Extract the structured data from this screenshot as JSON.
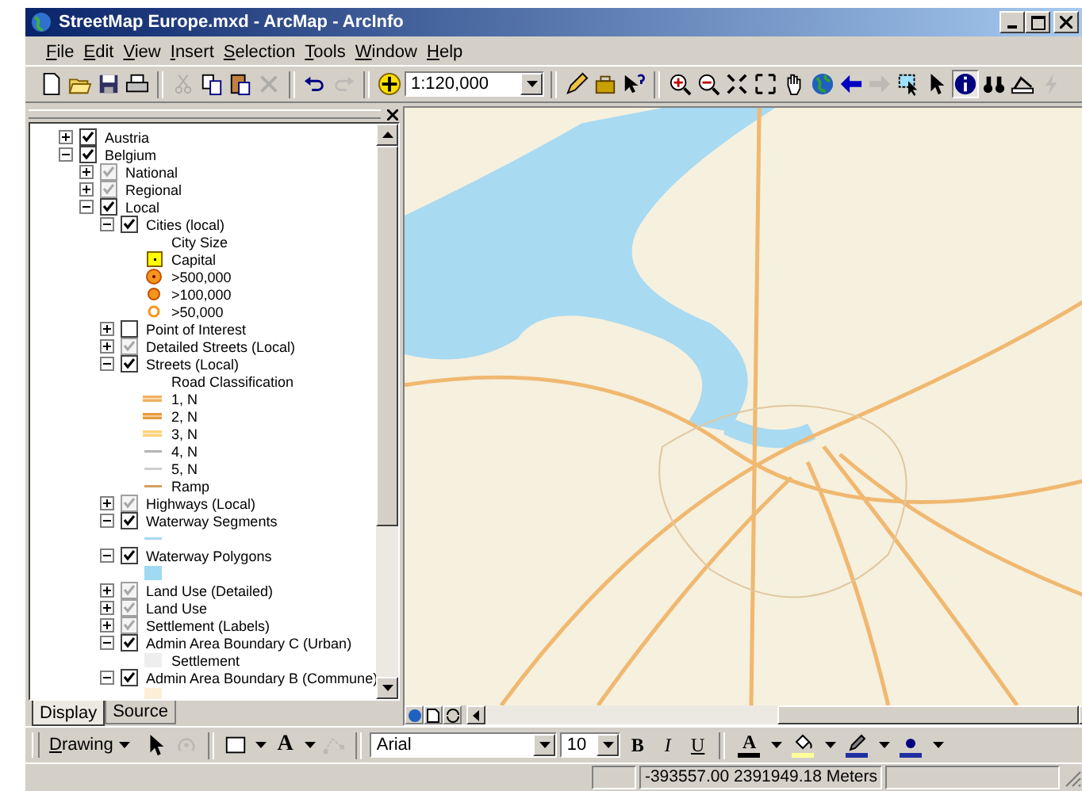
{
  "window": {
    "title": "StreetMap Europe.mxd - ArcMap - ArcInfo"
  },
  "menu": [
    "File",
    "Edit",
    "View",
    "Insert",
    "Selection",
    "Tools",
    "Window",
    "Help"
  ],
  "toolbar": [
    {
      "kind": "new",
      "disabled": false
    },
    {
      "kind": "open",
      "disabled": false
    },
    {
      "kind": "save",
      "disabled": false
    },
    {
      "kind": "print",
      "disabled": false
    },
    {
      "kind": "separator"
    },
    {
      "kind": "cut",
      "disabled": true
    },
    {
      "kind": "copy",
      "disabled": false
    },
    {
      "kind": "paste",
      "disabled": false
    },
    {
      "kind": "delete",
      "disabled": true
    },
    {
      "kind": "separator"
    },
    {
      "kind": "undo",
      "disabled": false
    },
    {
      "kind": "redo",
      "disabled": true
    },
    {
      "kind": "separator"
    },
    {
      "kind": "add-data",
      "disabled": false
    },
    {
      "kind": "scale",
      "value": "1:120,000"
    },
    {
      "kind": "separator"
    },
    {
      "kind": "editor",
      "disabled": false
    },
    {
      "kind": "toolbox",
      "disabled": false
    },
    {
      "kind": "whats-this",
      "disabled": false
    },
    {
      "kind": "separator"
    },
    {
      "kind": "zoom-in",
      "disabled": false,
      "selected": false
    },
    {
      "kind": "zoom-out",
      "disabled": false,
      "selected": false
    },
    {
      "kind": "fixed-in",
      "disabled": false
    },
    {
      "kind": "fixed-out",
      "disabled": false
    },
    {
      "kind": "pan",
      "disabled": false,
      "selected": false
    },
    {
      "kind": "globe",
      "disabled": false
    },
    {
      "kind": "back",
      "disabled": false
    },
    {
      "kind": "forward",
      "disabled": true
    },
    {
      "kind": "select-features",
      "disabled": false,
      "selected": false
    },
    {
      "kind": "pointer",
      "disabled": false,
      "selected": false
    },
    {
      "kind": "identify",
      "disabled": false,
      "selected": true
    },
    {
      "kind": "find",
      "disabled": false
    },
    {
      "kind": "measure",
      "disabled": false,
      "selected": false
    },
    {
      "kind": "hyperlink",
      "disabled": true,
      "selected": false
    }
  ],
  "toc": {
    "layers": [
      {
        "label": "Austria",
        "expanded": false,
        "checked": true,
        "dimmed": false
      },
      {
        "label": "Belgium",
        "expanded": true,
        "checked": true,
        "dimmed": false,
        "children": [
          {
            "label": "National",
            "expanded": false,
            "checked": true,
            "dimmed": true
          },
          {
            "label": "Regional",
            "expanded": false,
            "checked": true,
            "dimmed": true
          },
          {
            "label": "Local",
            "expanded": true,
            "checked": true,
            "dimmed": false,
            "children": [
              {
                "label": "Cities (local)",
                "expanded": true,
                "checked": true,
                "dimmed": false,
                "legend": [
                  {
                    "kind": "heading",
                    "label": "City Size"
                  },
                  {
                    "kind": "square",
                    "label": "Capital",
                    "color": "#ffff00"
                  },
                  {
                    "kind": "ring",
                    "label": ">500,000",
                    "color": "#f7941d"
                  },
                  {
                    "kind": "dot",
                    "label": ">100,000",
                    "color": "#f7941d"
                  },
                  {
                    "kind": "hollow",
                    "label": ">50,000",
                    "color": "#f7941d"
                  }
                ]
              },
              {
                "label": "Point of Interest",
                "expanded": false,
                "checked": false,
                "dimmed": false
              },
              {
                "label": "Detailed Streets (Local)",
                "expanded": false,
                "checked": true,
                "dimmed": true
              },
              {
                "label": "Streets (Local)",
                "expanded": true,
                "checked": true,
                "dimmed": false,
                "legend": [
                  {
                    "kind": "heading",
                    "label": "Road Classification"
                  },
                  {
                    "kind": "double-line",
                    "label": "1, N",
                    "color": "#f0b060"
                  },
                  {
                    "kind": "double-line",
                    "label": "2, N",
                    "color": "#e89a3c"
                  },
                  {
                    "kind": "double-line",
                    "label": "3, N",
                    "color": "#ffd27a"
                  },
                  {
                    "kind": "line",
                    "label": "4, N",
                    "color": "#b4b4b4"
                  },
                  {
                    "kind": "line",
                    "label": "5, N",
                    "color": "#cfcfcf"
                  },
                  {
                    "kind": "line",
                    "label": "Ramp",
                    "color": "#d4a060"
                  }
                ]
              },
              {
                "label": "Highways (Local)",
                "expanded": false,
                "checked": true,
                "dimmed": true
              },
              {
                "label": "Waterway Segments",
                "expanded": true,
                "checked": true,
                "dimmed": false,
                "legend": [
                  {
                    "kind": "line",
                    "color": "#a8d8f0"
                  }
                ]
              },
              {
                "label": "Waterway Polygons",
                "expanded": true,
                "checked": true,
                "dimmed": false,
                "legend": [
                  {
                    "kind": "fill",
                    "color": "#9fd9f2"
                  }
                ]
              },
              {
                "label": "Land Use (Detailed)",
                "expanded": false,
                "checked": true,
                "dimmed": true
              },
              {
                "label": "Land Use",
                "expanded": false,
                "checked": true,
                "dimmed": true
              },
              {
                "label": "Settlement (Labels)",
                "expanded": false,
                "checked": true,
                "dimmed": true
              },
              {
                "label": "Admin Area Boundary C (Urban)",
                "expanded": true,
                "checked": true,
                "dimmed": false,
                "legend": [
                  {
                    "kind": "fill",
                    "label": "Settlement",
                    "color": "#eeeeee"
                  }
                ]
              },
              {
                "label": "Admin Area Boundary B (Commune)",
                "expanded": true,
                "checked": true,
                "dimmed": false,
                "legend": [
                  {
                    "kind": "fill",
                    "color": "#fdeed8"
                  }
                ]
              }
            ]
          }
        ]
      }
    ],
    "tabs": [
      {
        "label": "Display",
        "selected": true
      },
      {
        "label": "Source",
        "selected": false
      }
    ]
  },
  "drawing_toolbar": [
    {
      "kind": "menu",
      "label": "Drawing"
    },
    {
      "kind": "pointer",
      "disabled": false
    },
    {
      "kind": "rotate",
      "disabled": true
    },
    {
      "kind": "separator"
    },
    {
      "kind": "rectangle",
      "disabled": false
    },
    {
      "kind": "text",
      "label": "A",
      "disabled": false
    },
    {
      "kind": "vertices",
      "disabled": true
    },
    {
      "kind": "separator"
    },
    {
      "kind": "font",
      "value": "Arial"
    },
    {
      "kind": "size",
      "value": "10"
    },
    {
      "kind": "bold",
      "label": "B"
    },
    {
      "kind": "italic",
      "label": "I"
    },
    {
      "kind": "underline",
      "label": "U"
    },
    {
      "kind": "separator"
    },
    {
      "kind": "font-color",
      "label": "A",
      "color": "#000000"
    },
    {
      "kind": "fill-color",
      "color": "#ffff99"
    },
    {
      "kind": "line-color",
      "color": "#2030a0"
    },
    {
      "kind": "marker-color",
      "color": "#2030a0"
    }
  ],
  "status_bar": {
    "coordinates": "-393557.00  2391949.18 Meters"
  }
}
